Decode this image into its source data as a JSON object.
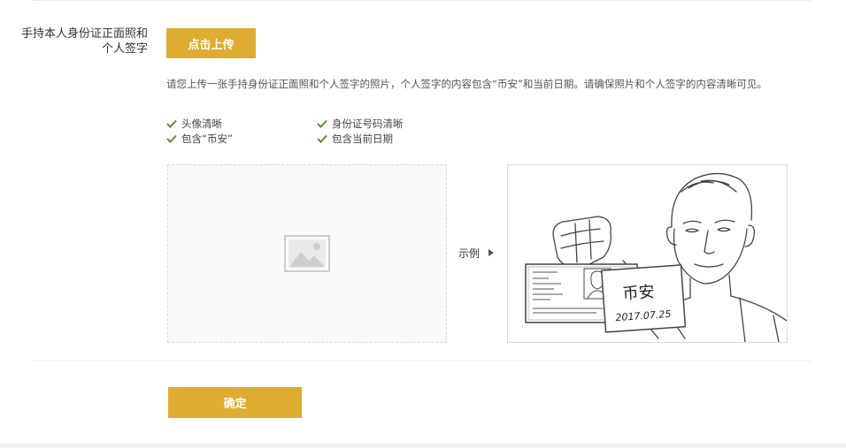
{
  "form": {
    "label": "手持本人身份证正面照和个人签字",
    "upload_button": "点击上传",
    "instructions": "请您上传一张手持身份证正面照和个人签字的照片，个人签字的内容包含“币安”和当前日期。请确保照片和个人签字的内容清晰可见。",
    "checks": [
      {
        "label": "头像清晰",
        "icon": "check-icon"
      },
      {
        "label": "身份证号码清晰",
        "icon": "check-icon"
      },
      {
        "label": "包含“币安”",
        "icon": "check-icon"
      },
      {
        "label": "包含当前日期",
        "icon": "check-icon"
      }
    ],
    "upload_placeholder_icon": "image-placeholder-icon",
    "example_label": "示例",
    "example_arrow_icon": "caret-right-icon",
    "example_sign_name": "币安",
    "example_sign_date": "2017.07.25",
    "confirm_button": "确定"
  },
  "colors": {
    "accent": "#dfac32",
    "check": "#5a8f3b"
  }
}
